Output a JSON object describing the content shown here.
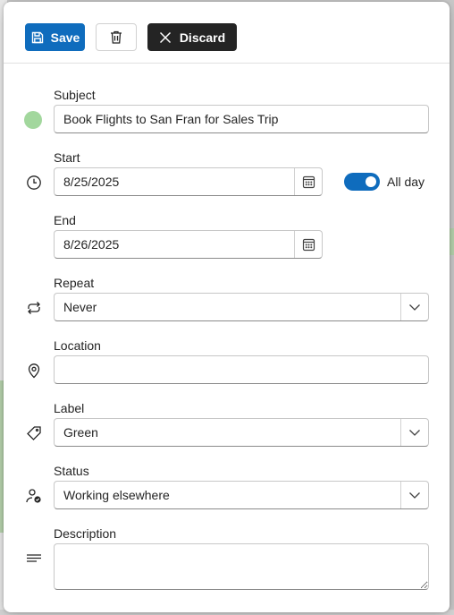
{
  "toolbar": {
    "save_label": "Save",
    "discard_label": "Discard"
  },
  "subject": {
    "label": "Subject",
    "value": "Book Flights to San Fran for Sales Trip",
    "category_color": "#a2d79d"
  },
  "start": {
    "label": "Start",
    "value": "8/25/2025"
  },
  "all_day": {
    "label": "All day",
    "checked": true
  },
  "end": {
    "label": "End",
    "value": "8/26/2025"
  },
  "repeat": {
    "label": "Repeat",
    "value": "Never"
  },
  "location": {
    "label": "Location",
    "value": ""
  },
  "label_field": {
    "label": "Label",
    "value": "Green"
  },
  "status": {
    "label": "Status",
    "value": "Working elsewhere"
  },
  "description": {
    "label": "Description",
    "value": ""
  },
  "accent_color": "#0f6cbd"
}
